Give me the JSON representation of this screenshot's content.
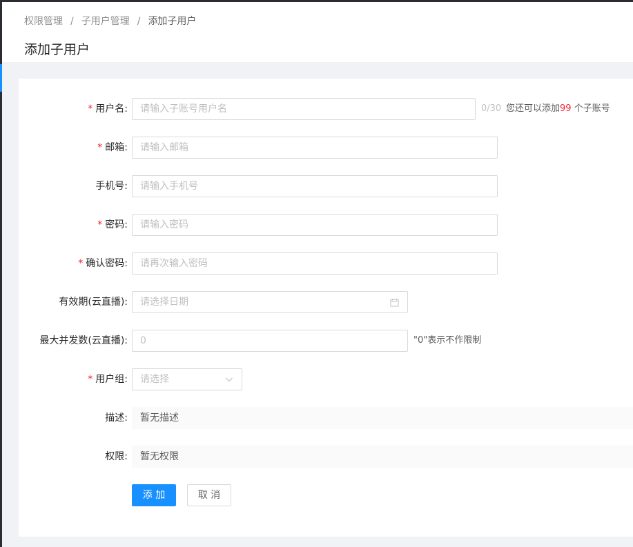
{
  "breadcrumb": {
    "items": [
      "权限管理",
      "子用户管理",
      "添加子用户"
    ],
    "separator": "/"
  },
  "page_title": "添加子用户",
  "form": {
    "username": {
      "required": true,
      "label": "用户名:",
      "placeholder": "请输入子账号用户名",
      "counter": "0/30",
      "hint_prefix": "您还可以添加",
      "hint_count": "99",
      "hint_suffix": " 个子账号"
    },
    "email": {
      "required": true,
      "label": "邮箱:",
      "placeholder": "请输入邮箱"
    },
    "phone": {
      "required": false,
      "label": "手机号:",
      "placeholder": "请输入手机号"
    },
    "password": {
      "required": true,
      "label": "密码:",
      "placeholder": "请输入密码"
    },
    "confirm_password": {
      "required": true,
      "label": "确认密码:",
      "placeholder": "请再次输入密码"
    },
    "expiry": {
      "required": false,
      "label": "有效期(云直播):",
      "placeholder": "请选择日期",
      "icon": "calendar-icon"
    },
    "max_concurrency": {
      "required": false,
      "label": "最大并发数(云直播):",
      "placeholder": "0",
      "hint": "\"0\"表示不作限制"
    },
    "user_group": {
      "required": true,
      "label": "用户组:",
      "placeholder": "请选择",
      "icon": "chevron-down-icon"
    },
    "description": {
      "label": "描述:",
      "value": "暂无描述"
    },
    "permissions": {
      "label": "权限:",
      "value": "暂无权限"
    },
    "required_mark": "*"
  },
  "actions": {
    "submit_label": "添 加",
    "cancel_label": "取 消"
  },
  "colors": {
    "primary": "#1890ff",
    "required": "#f5222d",
    "sidebar": "#2a2d31"
  }
}
